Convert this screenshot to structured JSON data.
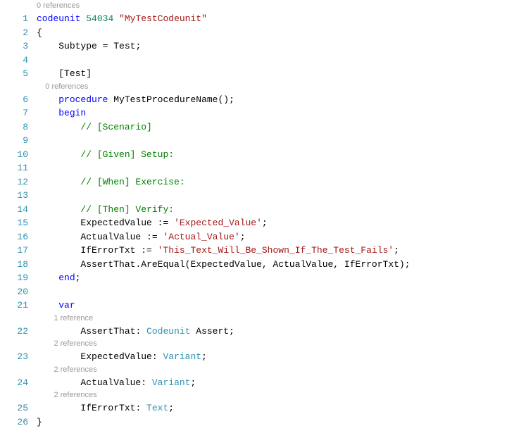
{
  "codelens": {
    "top": "0 references",
    "proc": "0 references",
    "v1": "1 reference",
    "v2": "2 references",
    "v3": "2 references",
    "v4": "2 references"
  },
  "lineNumbers": [
    "1",
    "2",
    "3",
    "4",
    "5",
    "6",
    "7",
    "8",
    "9",
    "10",
    "11",
    "12",
    "13",
    "14",
    "15",
    "16",
    "17",
    "18",
    "19",
    "20",
    "21",
    "22",
    "23",
    "24",
    "25",
    "26"
  ],
  "tokens": {
    "l1": {
      "kw": "codeunit",
      "sp": " ",
      "num": "54034",
      "sp2": " ",
      "str": "\"MyTestCodeunit\""
    },
    "l2": {
      "t": "{"
    },
    "l3": {
      "ind": "    ",
      "id1": "Subtype",
      "op": " = ",
      "id2": "Test",
      "end": ";"
    },
    "l4": {
      "t": ""
    },
    "l5": {
      "ind": "    ",
      "attr1": "[",
      "attr2": "Test",
      "attr3": "]"
    },
    "l6": {
      "ind": "    ",
      "kw": "procedure",
      "sp": " ",
      "name": "MyTestProcedureName",
      "paren": "();"
    },
    "l7": {
      "ind": "    ",
      "kw": "begin"
    },
    "l8": {
      "ind": "        ",
      "cmt": "// [Scenario]"
    },
    "l9": {
      "t": ""
    },
    "l10": {
      "ind": "        ",
      "cmt": "// [Given] Setup:"
    },
    "l11": {
      "t": ""
    },
    "l12": {
      "ind": "        ",
      "cmt": "// [When] Exercise:"
    },
    "l13": {
      "t": ""
    },
    "l14": {
      "ind": "        ",
      "cmt": "// [Then] Verify:"
    },
    "l15": {
      "ind": "        ",
      "id": "ExpectedValue",
      "op": " := ",
      "str": "'Expected_Value'",
      "end": ";"
    },
    "l16": {
      "ind": "        ",
      "id": "ActualValue",
      "op": " := ",
      "str": "'Actual_Value'",
      "end": ";"
    },
    "l17": {
      "ind": "        ",
      "id": "IfErrorTxt",
      "op": " := ",
      "str": "'This_Text_Will_Be_Shown_If_The_Test_Fails'",
      "end": ";"
    },
    "l18": {
      "ind": "        ",
      "id1": "AssertThat",
      "dot": ".",
      "id2": "AreEqual",
      "args": "(ExpectedValue, ActualValue, IfErrorTxt);"
    },
    "l19": {
      "ind": "    ",
      "kw": "end",
      "end": ";"
    },
    "l20": {
      "t": ""
    },
    "l21": {
      "ind": "    ",
      "kw": "var"
    },
    "l22": {
      "ind": "        ",
      "id": "AssertThat",
      "col": ": ",
      "type": "Codeunit",
      "sp": " ",
      "sub": "Assert",
      "end": ";"
    },
    "l23": {
      "ind": "        ",
      "id": "ExpectedValue",
      "col": ": ",
      "type": "Variant",
      "end": ";"
    },
    "l24": {
      "ind": "        ",
      "id": "ActualValue",
      "col": ": ",
      "type": "Variant",
      "end": ";"
    },
    "l25": {
      "ind": "        ",
      "id": "IfErrorTxt",
      "col": ": ",
      "type": "Text",
      "end": ";"
    },
    "l26": {
      "t": "}"
    }
  },
  "codelensIndent": {
    "top": "",
    "proc": "    ",
    "var": "        "
  }
}
